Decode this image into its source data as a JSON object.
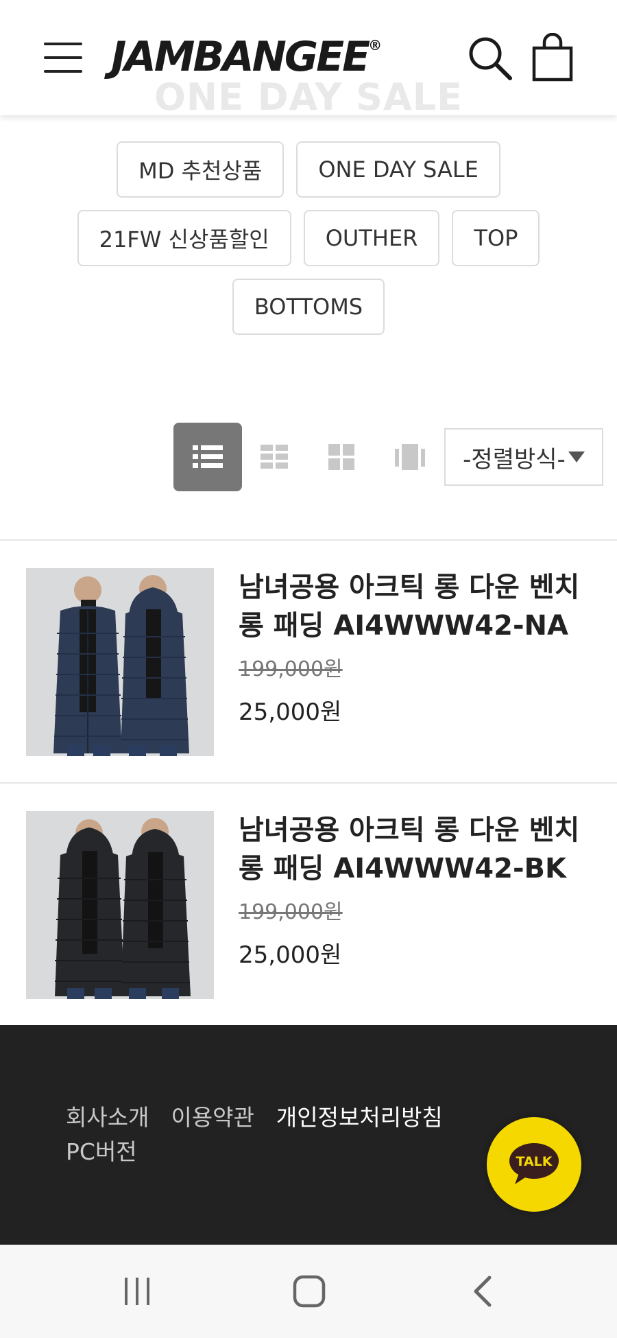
{
  "header": {
    "logo": "JAMBANGEE",
    "logo_mark": "®",
    "ghost_title": "ONE DAY SALE"
  },
  "categories": {
    "row1": [
      "MD 추천상품",
      "ONE DAY SALE"
    ],
    "row2": [
      "21FW 신상품할인",
      "OUTHER",
      "TOP"
    ],
    "row3": [
      "BOTTOMS"
    ]
  },
  "toolbar": {
    "view_modes": [
      "list-view-icon",
      "grid-2-icon",
      "grid-4-icon",
      "gallery-icon"
    ],
    "active_view": "list-view-icon",
    "sort_label": "-정렬방식-"
  },
  "products": [
    {
      "name": "남녀공용 아크틱 롱 다운 벤치 롱 패딩 AI4WWW42-NA",
      "old_price": "199,000원",
      "price": "25,000원",
      "image_label": "Jambangee",
      "coat_color": "#2e3b55"
    },
    {
      "name": "남녀공용 아크틱 롱 다운 벤치 롱 패딩 AI4WWW42-BK",
      "old_price": "199,000원",
      "price": "25,000원",
      "image_label": "Jambangee",
      "coat_color": "#25272b"
    }
  ],
  "footer": {
    "links": [
      "회사소개",
      "이용약관",
      "개인정보처리방침"
    ],
    "pc_version": "PC버전",
    "talk_label": "TALK"
  },
  "colors": {
    "footer_bg": "#222222",
    "talk_yellow": "#f5d800",
    "active_view_bg": "#777777"
  }
}
